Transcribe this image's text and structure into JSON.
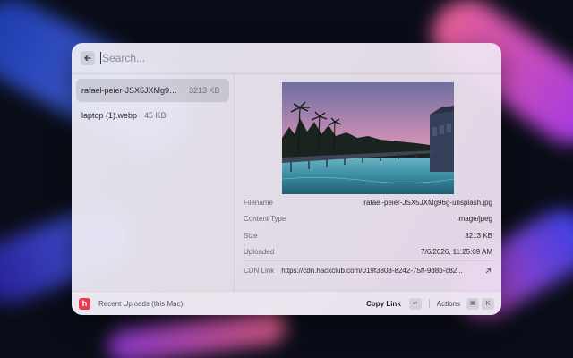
{
  "search": {
    "placeholder": "Search..."
  },
  "files": [
    {
      "name": "rafael-peier-JSX5JXMg96g-unsplash.jpg",
      "size": "3213 KB",
      "selected": true
    },
    {
      "name": "laptop (1).webp",
      "size": "45 KB",
      "selected": false
    }
  ],
  "details": {
    "filename_label": "Filename",
    "filename": "rafael-peier-JSX5JXMg96g-unsplash.jpg",
    "content_type_label": "Content Type",
    "content_type": "image/jpeg",
    "size_label": "Size",
    "size": "3213 KB",
    "uploaded_label": "Uploaded",
    "uploaded": "7/6/2026, 11:25:09 AM",
    "cdn_label": "CDN Link",
    "cdn_url": "https://cdn.hackclub.com/019f3808-8242-75ff-9d8b-c82..."
  },
  "footer": {
    "app_icon_letter": "h",
    "source_label": "Recent Uploads (this Mac)",
    "primary_action": "Copy Link",
    "primary_shortcut": "↵",
    "actions_label": "Actions",
    "actions_shortcut_mod": "⌘",
    "actions_shortcut_key": "K"
  },
  "colors": {
    "app_icon": "#ec3750"
  },
  "icons": {
    "back": "arrow-left-icon",
    "external": "arrow-up-right-icon"
  }
}
